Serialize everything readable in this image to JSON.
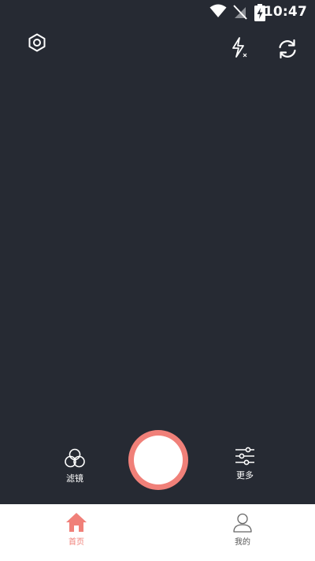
{
  "status_bar": {
    "time": "10:47"
  },
  "camera": {
    "filter_label": "滤镜",
    "more_label": "更多"
  },
  "tabs": [
    {
      "label": "首页",
      "active": true
    },
    {
      "label": "我的",
      "active": false
    }
  ],
  "colors": {
    "background": "#262a33",
    "accent": "#f08079",
    "shutter_inner": "#ffffff",
    "tab_bar": "#ffffff"
  }
}
